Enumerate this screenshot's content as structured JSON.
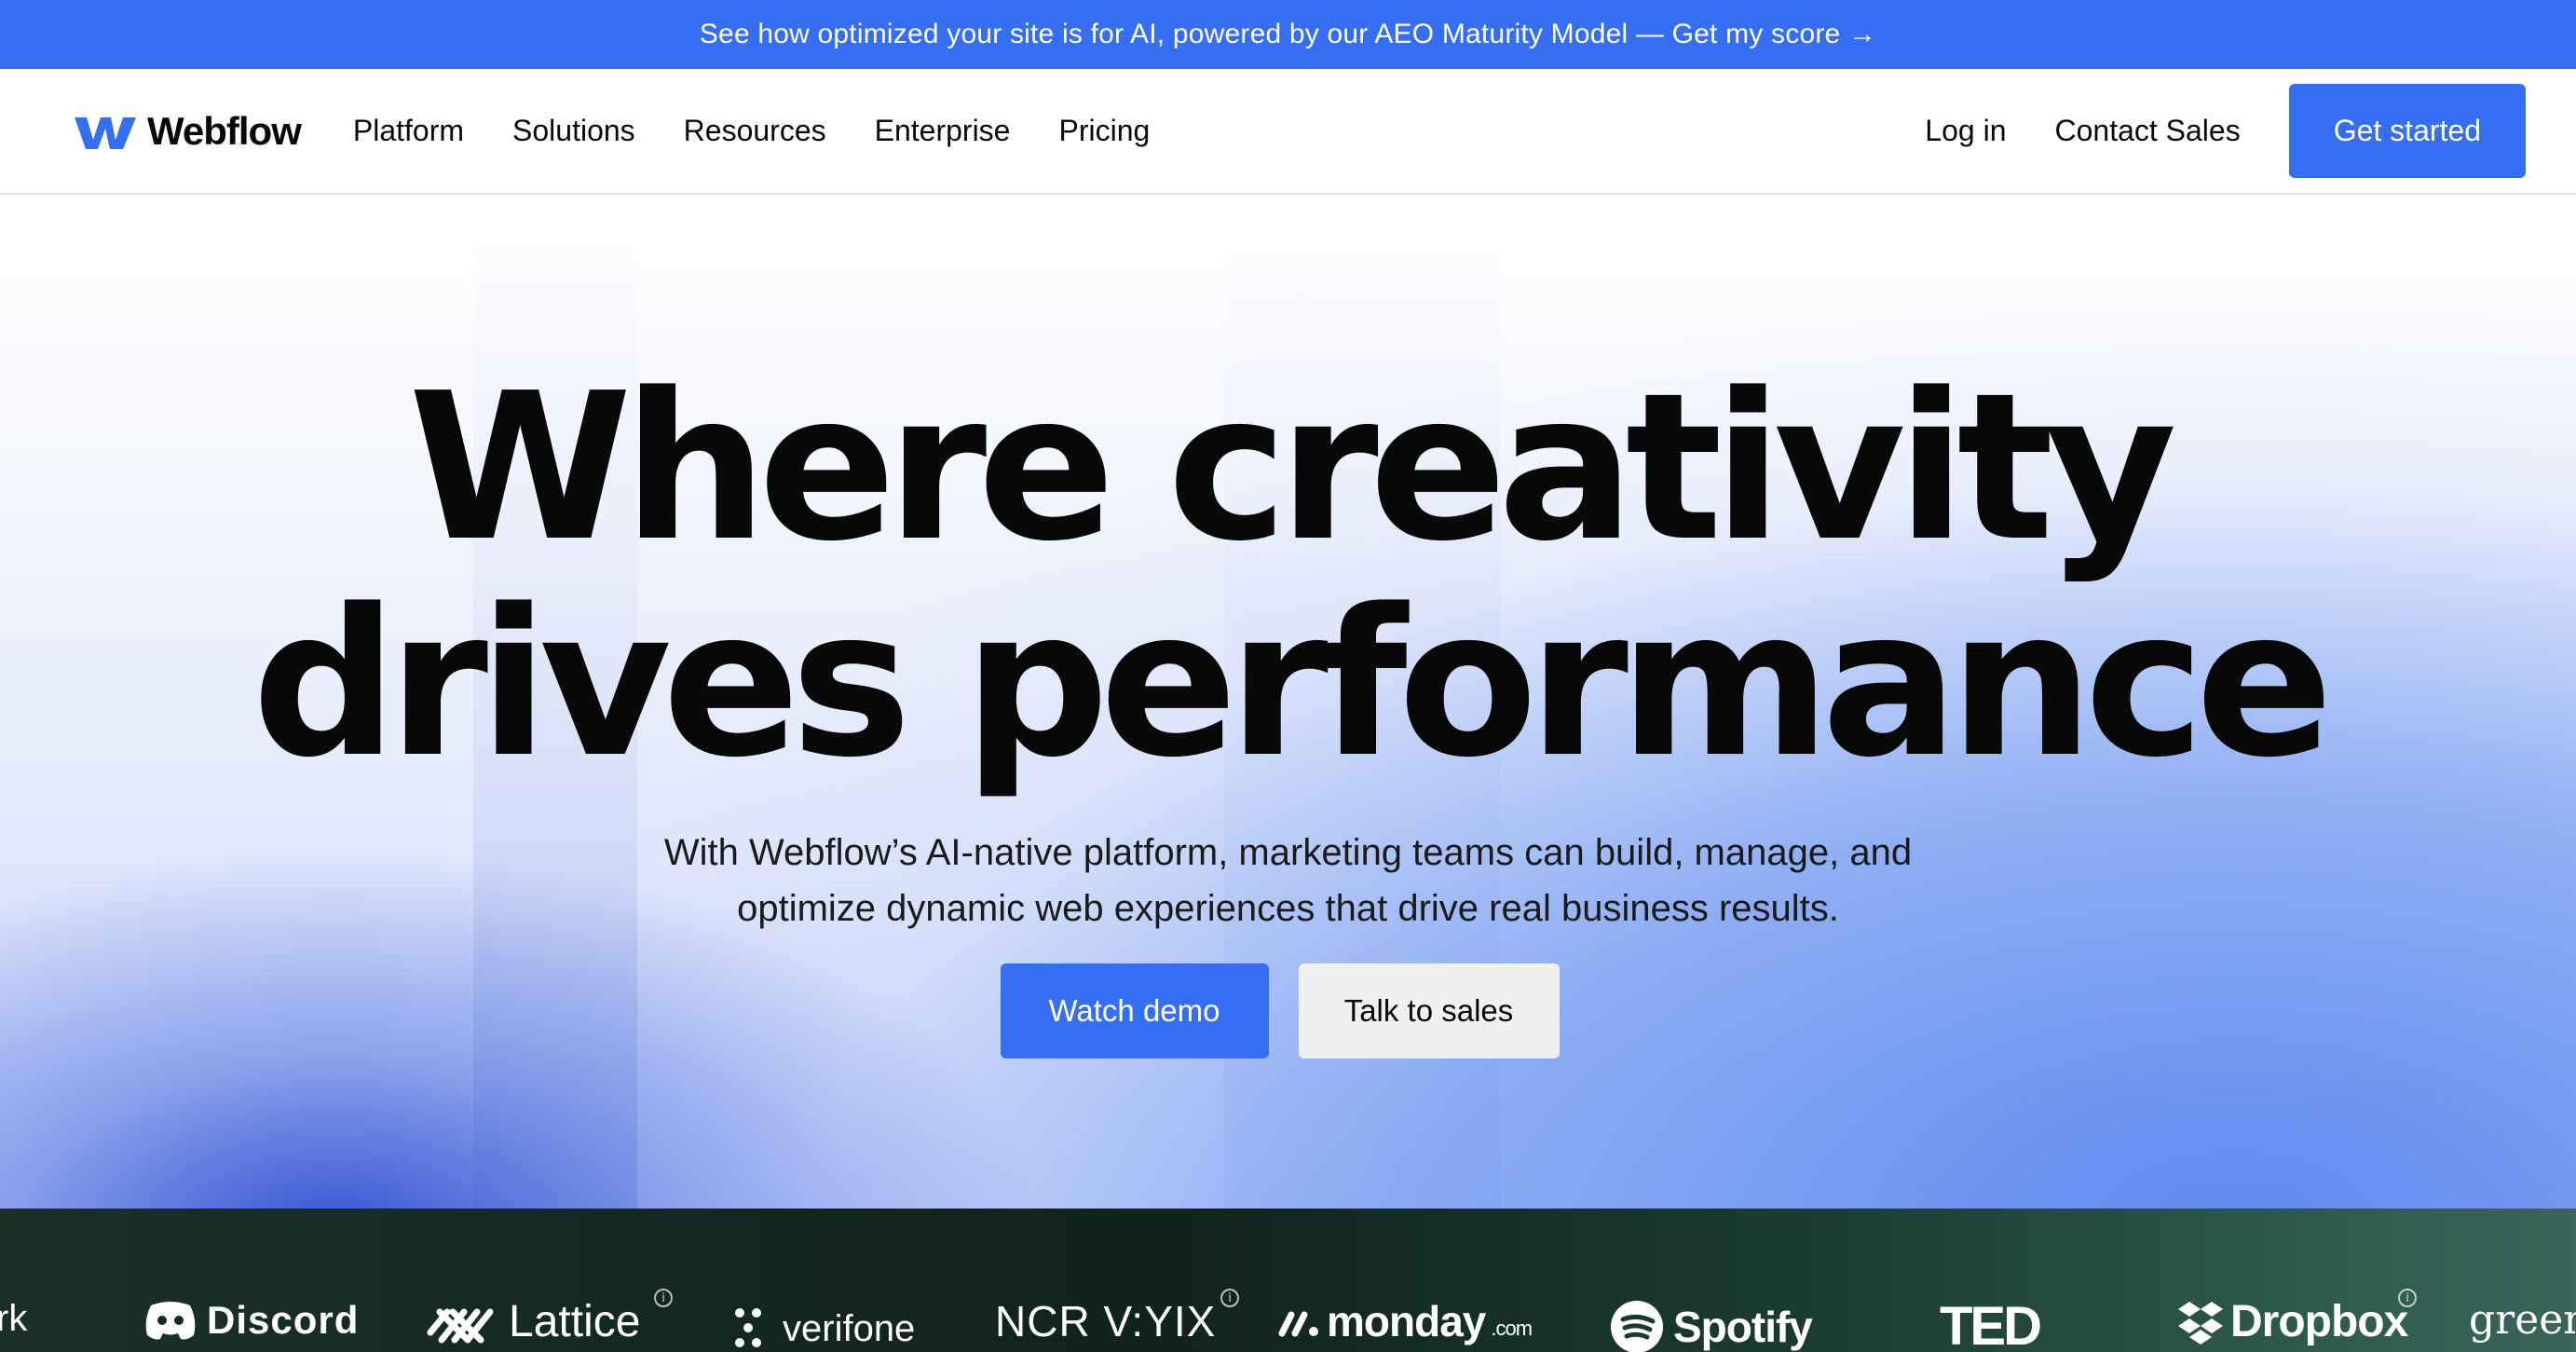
{
  "announcement": {
    "text": "See how optimized your site is for AI, powered by our AEO Maturity Model — Get my score →"
  },
  "nav": {
    "brand": "Webflow",
    "links": [
      "Platform",
      "Solutions",
      "Resources",
      "Enterprise",
      "Pricing"
    ],
    "login": "Log in",
    "contact": "Contact Sales",
    "cta": "Get started"
  },
  "hero": {
    "headline_line1": "Where creativity",
    "headline_line2": "drives performance",
    "subtitle_line1": "With Webflow’s AI-native platform, marketing teams can build, manage, and",
    "subtitle_line2": "optimize dynamic web experiences that drive real business results.",
    "primary_button": "Watch demo",
    "secondary_button": "Talk to sales"
  },
  "logos": {
    "items": [
      "rk",
      "Discord",
      "Lattice",
      "verifone",
      "NCR V:YIX",
      "monday",
      ".com",
      "Spotify",
      "TED",
      "Dropbox",
      "greenh"
    ],
    "info_glyph": "i"
  },
  "colors": {
    "accent": "#356ef0",
    "text": "#080808",
    "logo_strip": "#142a22"
  },
  "icons": [
    "webflow-logo-icon",
    "discord-icon",
    "lattice-icon",
    "verifone-dots-icon",
    "monday-icon",
    "spotify-icon",
    "dropbox-icon",
    "info-icon"
  ]
}
